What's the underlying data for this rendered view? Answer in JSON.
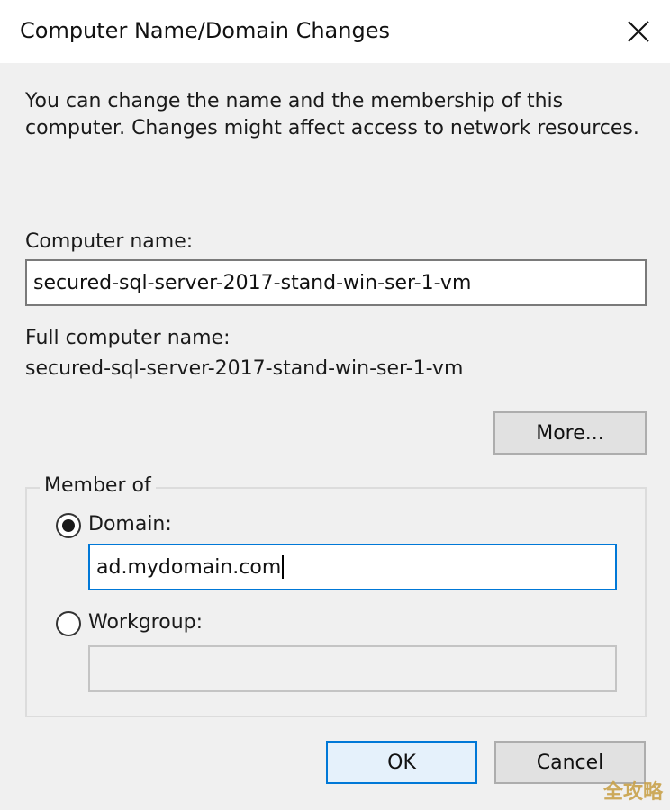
{
  "window": {
    "title": "Computer Name/Domain Changes",
    "close_glyph": "✕"
  },
  "description": "You can change the name and the membership of this computer. Changes might affect access to network resources.",
  "computer_name": {
    "label": "Computer name:",
    "value": "secured-sql-server-2017-stand-win-ser-1-vm"
  },
  "full_computer_name": {
    "label": "Full computer name:",
    "value": "secured-sql-server-2017-stand-win-ser-1-vm"
  },
  "more_button": {
    "label": "More..."
  },
  "member_of": {
    "legend": "Member of",
    "domain": {
      "label": "Domain:",
      "selected": true,
      "value": "ad.mydomain.com"
    },
    "workgroup": {
      "label": "Workgroup:",
      "selected": false,
      "value": ""
    }
  },
  "buttons": {
    "ok": "OK",
    "cancel": "Cancel"
  },
  "watermark": "全攻略",
  "colors": {
    "accent": "#0078d7",
    "window_bg": "#f0f0f0",
    "watermark": "#c9a24a"
  }
}
